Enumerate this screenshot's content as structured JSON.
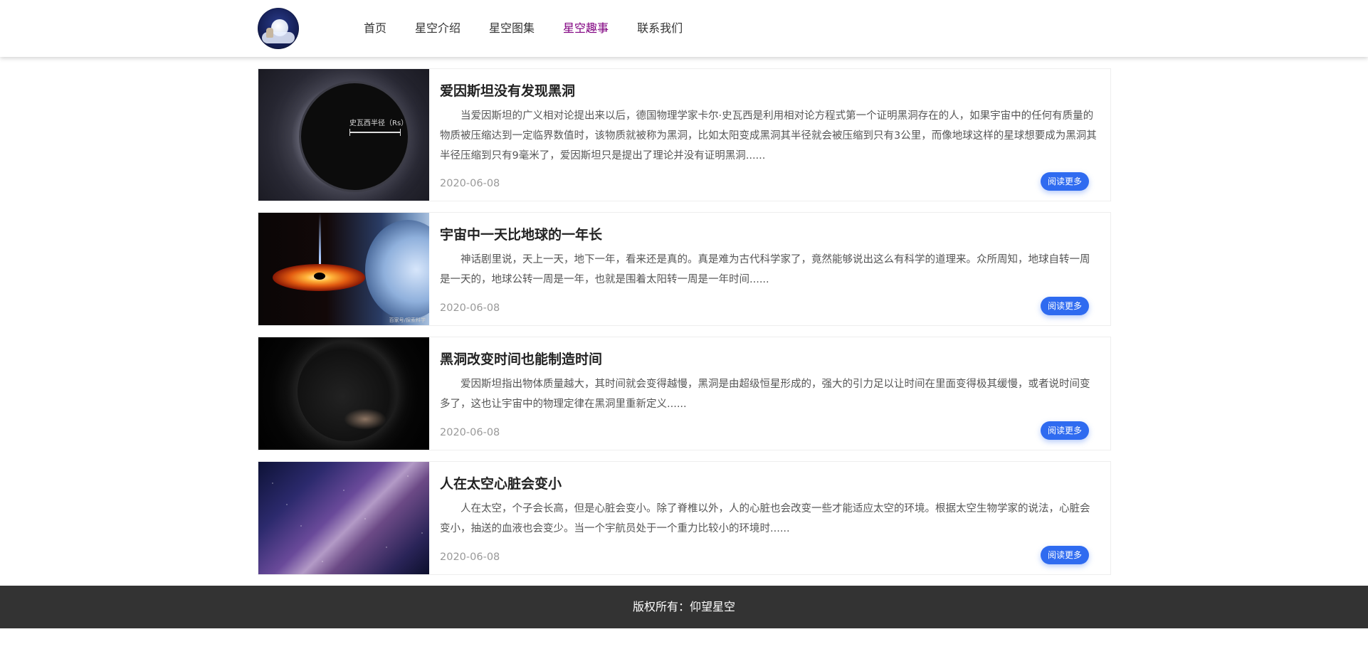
{
  "header": {
    "logo_alt": "仰望星空",
    "nav": [
      {
        "label": "首页",
        "active": false
      },
      {
        "label": "星空介绍",
        "active": false
      },
      {
        "label": "星空图集",
        "active": false
      },
      {
        "label": "星空趣事",
        "active": true
      },
      {
        "label": "联系我们",
        "active": false
      }
    ],
    "active_color": "#800080"
  },
  "articles": [
    {
      "title": "爱因斯坦没有发现黑洞",
      "excerpt": "当爱因斯坦的广义相对论提出来以后，德国物理学家卡尔·史瓦西是利用相对论方程式第一个证明黑洞存在的人，如果宇宙中的任何有质量的物质被压缩达到一定临界数值时，该物质就被称为黑洞，比如太阳变成黑洞其半径就会被压缩到只有3公里，而像地球这样的星球想要成为黑洞其半径压缩到只有9毫米了，爱因斯坦只是提出了理论并没有证明黑洞......",
      "date": "2020-06-08",
      "more": "阅读更多",
      "image_label": "史瓦西半径（Rs）"
    },
    {
      "title": "宇宙中一天比地球的一年长",
      "excerpt": "神话剧里说，天上一天，地下一年，看来还是真的。真是难为古代科学家了，竟然能够说出这么有科学的道理来。众所周知，地球自转一周是一天的，地球公转一周是一年，也就是围着太阳转一周是一年时间......",
      "date": "2020-06-08",
      "more": "阅读更多",
      "image_label": "百家号/探索科学"
    },
    {
      "title": "黑洞改变时间也能制造时间",
      "excerpt": "爱因斯坦指出物体质量越大，其时间就会变得越慢，黑洞是由超级恒星形成的，强大的引力足以让时间在里面变得极其缓慢，或者说时间变多了，这也让宇宙中的物理定律在黑洞里重新定义......",
      "date": "2020-06-08",
      "more": "阅读更多",
      "image_label": ""
    },
    {
      "title": "人在太空心脏会变小",
      "excerpt": "人在太空，个子会长高，但是心脏会变小。除了脊椎以外，人的心脏也会改变一些才能适应太空的环境。根据太空生物学家的说法，心脏会变小，抽送的血液也会变少。当一个宇航员处于一个重力比较小的环境时......",
      "date": "2020-06-08",
      "more": "阅读更多",
      "image_label": ""
    }
  ],
  "footer": {
    "copyright": "版权所有：仰望星空"
  },
  "colors": {
    "button": "#2f6bf0",
    "footer_bg": "#333333",
    "date": "#999999"
  }
}
